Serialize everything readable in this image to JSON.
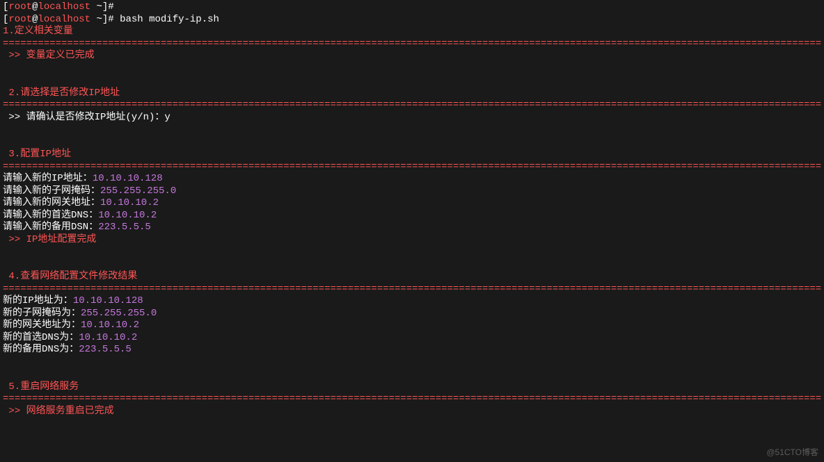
{
  "prompts": [
    {
      "user": "root",
      "host": "localhost",
      "path": "~",
      "cmd": ""
    },
    {
      "user": "root",
      "host": "localhost",
      "path": "~",
      "cmd": "bash modify-ip.sh"
    }
  ],
  "divider": "============================================================================================================================================",
  "section1": {
    "title": "1.定义相关变量",
    "result": " >> 变量定义已完成"
  },
  "section2": {
    "title": " 2.请选择是否修改IP地址",
    "prompt_label": " >> 请确认是否修改IP地址(y/n)：",
    "prompt_value": "y"
  },
  "section3": {
    "title": " 3.配置IP地址",
    "lines": [
      {
        "label": "请输入新的IP地址：",
        "value": "10.10.10.128"
      },
      {
        "label": "请输入新的子网掩码：",
        "value": "255.255.255.0"
      },
      {
        "label": "请输入新的网关地址：",
        "value": "10.10.10.2"
      },
      {
        "label": "请输入新的首选DNS：",
        "value": "10.10.10.2"
      },
      {
        "label": "请输入新的备用DSN：",
        "value": "223.5.5.5"
      }
    ],
    "result": " >> IP地址配置完成"
  },
  "section4": {
    "title": " 4.查看网络配置文件修改结果",
    "lines": [
      {
        "label": "新的IP地址为：",
        "value": "10.10.10.128"
      },
      {
        "label": "新的子网掩码为：",
        "value": "255.255.255.0"
      },
      {
        "label": "新的网关地址为：",
        "value": "10.10.10.2"
      },
      {
        "label": "新的首选DNS为：",
        "value": "10.10.10.2"
      },
      {
        "label": "新的备用DNS为：",
        "value": "223.5.5.5"
      }
    ]
  },
  "section5": {
    "title": " 5.重启网络服务",
    "result": " >> 网络服务重启已完成"
  },
  "watermark": "@51CTO博客"
}
